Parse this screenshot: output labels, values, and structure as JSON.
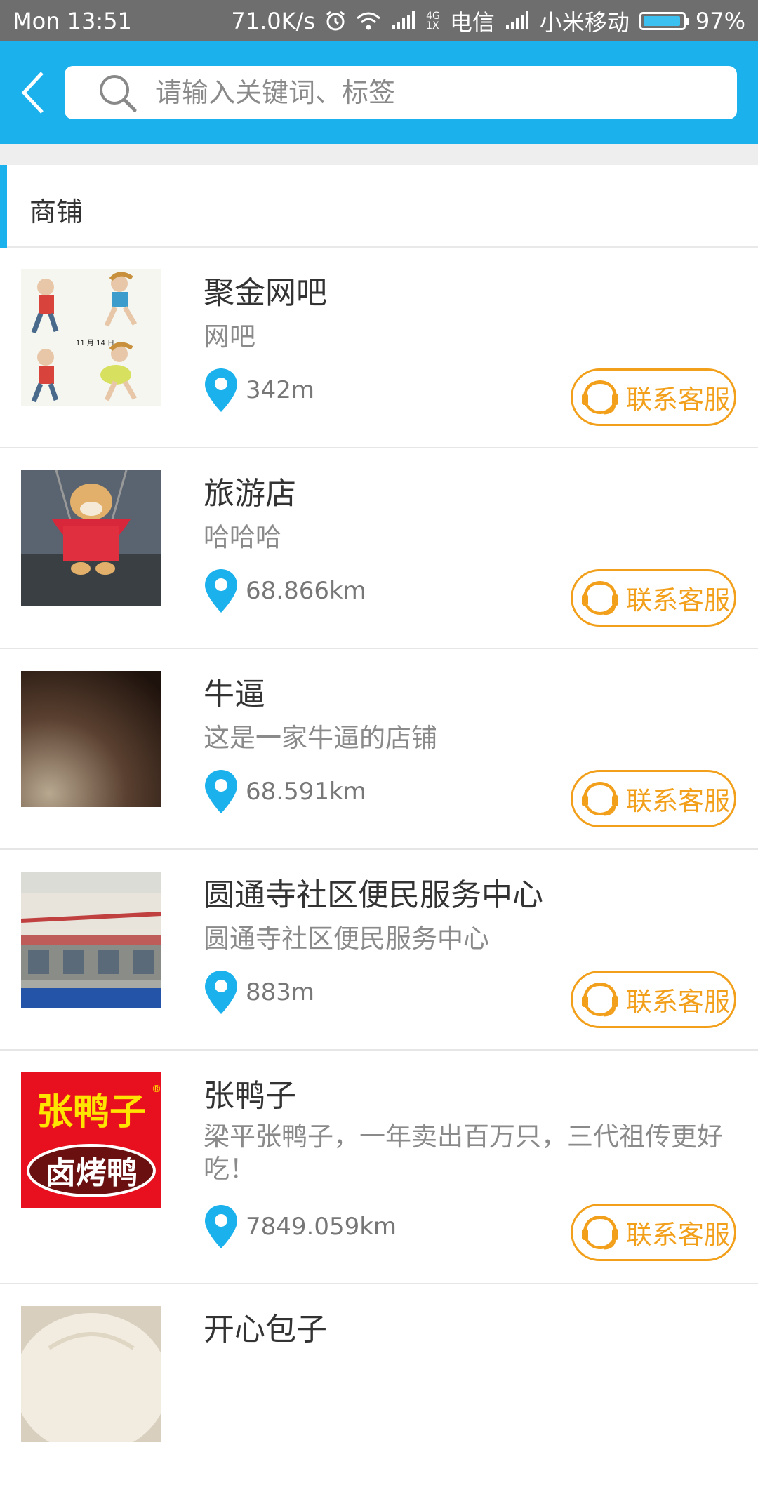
{
  "status_bar": {
    "time": "Mon 13:51",
    "speed": "71.0K/s",
    "net_type_top": "4G",
    "net_type_bottom": "1X",
    "carrier1": "电信",
    "carrier2": "小米移动",
    "battery": "97%",
    "battery_level": 0.97
  },
  "header": {
    "search_placeholder": "请输入关键词、标签",
    "accent_color": "#1ab1ec"
  },
  "section": {
    "title": "商铺"
  },
  "shops": [
    {
      "name": "聚金网吧",
      "desc": "网吧",
      "distance": "342m",
      "button": "联系客服",
      "image": "cartoon-runners"
    },
    {
      "name": "旅游店",
      "desc": "哈哈哈",
      "distance": "68.866km",
      "button": "联系客服",
      "image": "dog-on-swing"
    },
    {
      "name": "牛逼",
      "desc": "这是一家牛逼的店铺",
      "distance": "68.591km",
      "button": "联系客服",
      "image": "dark-brown-photo"
    },
    {
      "name": "圆通寺社区便民服务中心",
      "desc": "圆通寺社区便民服务中心",
      "distance": "883m",
      "button": "联系客服",
      "image": "building-facade"
    },
    {
      "name": "张鸭子",
      "desc": "梁平张鸭子，一年卖出百万只，三代祖传更好吃！",
      "distance": "7849.059km",
      "button": "联系客服",
      "image": "zhang-yazi-logo",
      "logo_text_1": "张鸭子",
      "logo_text_2": "卤烤鸭"
    },
    {
      "name": "开心包子",
      "desc": "",
      "distance": "",
      "button": "",
      "image": "steamed-bun"
    }
  ]
}
